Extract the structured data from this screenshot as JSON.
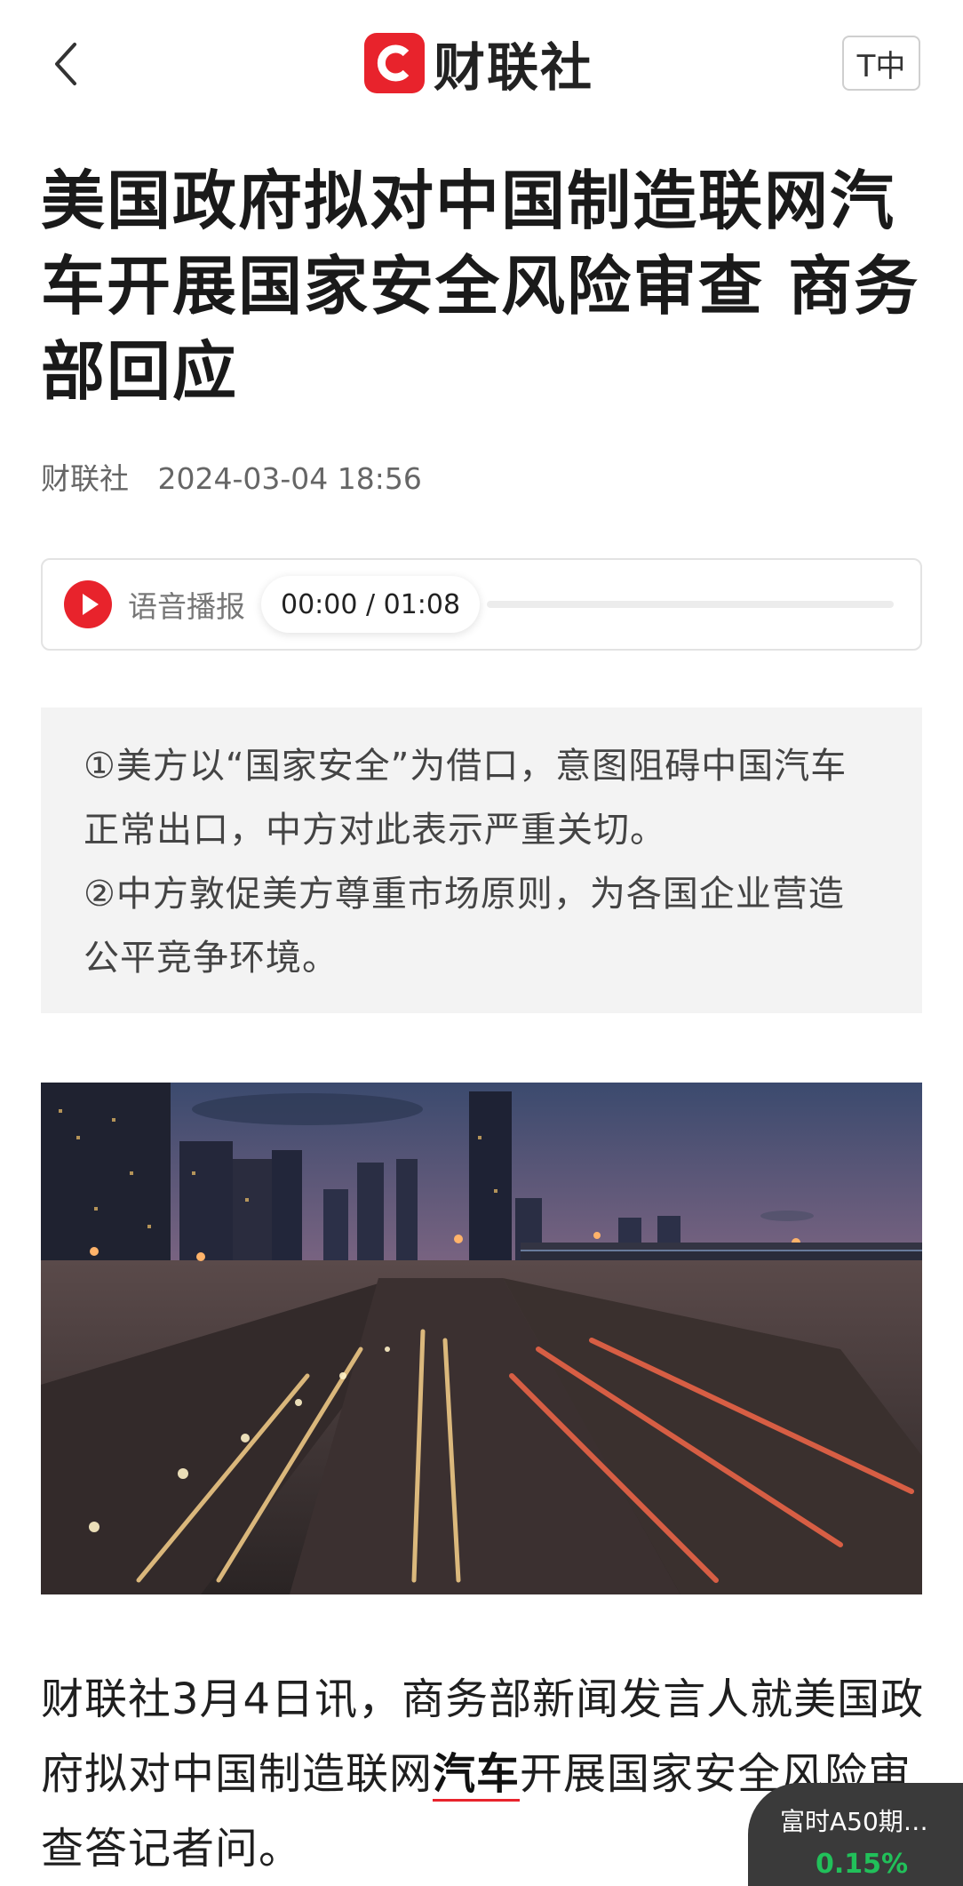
{
  "header": {
    "back_label": "<",
    "logo_letter": "C",
    "logo_text": "财联社",
    "font_toggle_label": "T中"
  },
  "article": {
    "title": "美国政府拟对中国制造联网汽车开展国家安全风险审查 商务部回应",
    "source": "财联社",
    "datetime": "2024-03-04 18:56",
    "audio": {
      "label": "语音播报",
      "time": "00:00 / 01:08",
      "progress": 0
    },
    "summary": [
      "①美方以“国家安全”为借口，意图阻碍中国汽车正常出口，中方对此表示严重关切。",
      "②中方敦促美方尊重市场原则，为各国企业营造公平竞争环境。"
    ],
    "body": {
      "before": "财联社3月4日讯，商务部新闻发言人就美国政府拟对中国制造联网",
      "keyword": "汽车",
      "after": "开展国家安全风险审查答记者问。"
    }
  },
  "ticker": {
    "name": "富时A50期…",
    "change": "0.15%"
  },
  "colors": {
    "brand_red": "#e8232c",
    "ticker_bg": "#3a3a3a",
    "ticker_up": "#21c05a"
  }
}
